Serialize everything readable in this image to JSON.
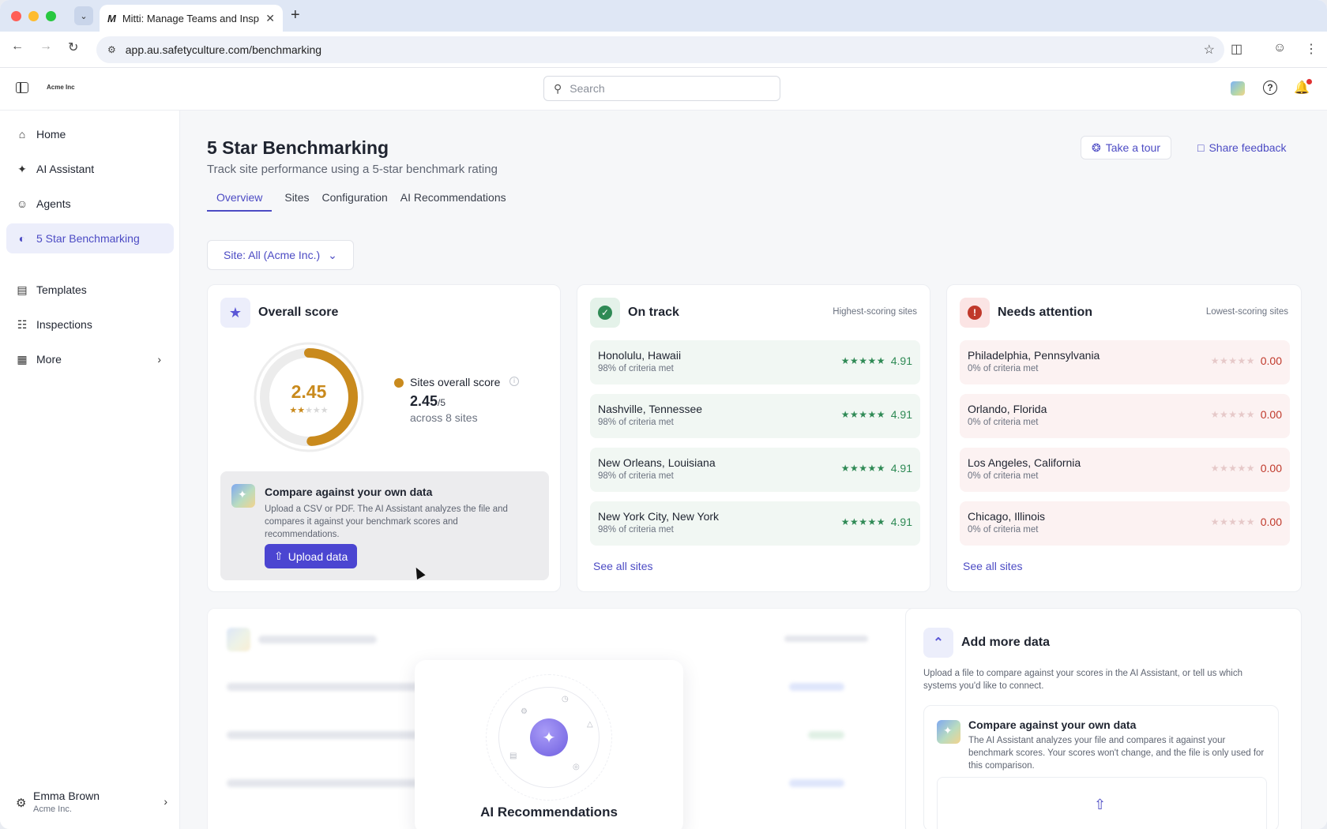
{
  "browser": {
    "tab_title": "Mitti: Manage Teams and Insp",
    "tab_favicon": "M",
    "url": "app.au.safetyculture.com/benchmarking"
  },
  "header": {
    "logo_text": "Acme Inc",
    "search_placeholder": "Search"
  },
  "sidebar": {
    "items": [
      {
        "label": "Home",
        "icon": "home-icon"
      },
      {
        "label": "AI Assistant",
        "icon": "sparkle-icon"
      },
      {
        "label": "Agents",
        "icon": "robot-icon"
      },
      {
        "label": "5 Star Benchmarking",
        "icon": "gauge-icon"
      },
      {
        "label": "Templates",
        "icon": "template-icon"
      },
      {
        "label": "Inspections",
        "icon": "clipboard-icon"
      },
      {
        "label": "More",
        "icon": "grid-icon"
      }
    ],
    "user": {
      "name": "Emma Brown",
      "org": "Acme Inc."
    }
  },
  "page": {
    "title": "5 Star Benchmarking",
    "subtitle": "Track site performance using a 5-star benchmark rating",
    "take_tour": "Take a tour",
    "share_feedback": "Share feedback",
    "tabs": [
      "Overview",
      "Sites",
      "Configuration",
      "AI Recommendations"
    ],
    "active_tab": "Overview",
    "site_filter": "Site: All (Acme Inc.)"
  },
  "overall": {
    "title": "Overall score",
    "score": "2.45",
    "score_value": 2.45,
    "score_max": 5,
    "legend_label": "Sites overall score",
    "score_text": "2.45",
    "denominator": "/5",
    "sites_text": "across 8 sites",
    "accent": "#c98a1d",
    "compare": {
      "title": "Compare against your own data",
      "desc": "Upload a CSV or PDF. The AI Assistant analyzes the file and compares it against your benchmark scores and recommendations.",
      "button": "Upload data"
    }
  },
  "on_track": {
    "title": "On track",
    "hint": "Highest-scoring sites",
    "see_all": "See all sites",
    "color": "#2f8a55",
    "sites": [
      {
        "name": "Honolulu, Hawaii",
        "meta": "98% of criteria met",
        "score": "4.91"
      },
      {
        "name": "Nashville, Tennessee",
        "meta": "98% of criteria met",
        "score": "4.91"
      },
      {
        "name": "New Orleans, Louisiana",
        "meta": "98% of criteria met",
        "score": "4.91"
      },
      {
        "name": "New York City, New York",
        "meta": "98% of criteria met",
        "score": "4.91"
      }
    ]
  },
  "needs_attention": {
    "title": "Needs attention",
    "hint": "Lowest-scoring sites",
    "see_all": "See all sites",
    "color": "#c0392b",
    "sites": [
      {
        "name": "Philadelphia, Pennsylvania",
        "meta": "0% of criteria met",
        "score": "0.00"
      },
      {
        "name": "Orlando, Florida",
        "meta": "0% of criteria met",
        "score": "0.00"
      },
      {
        "name": "Los Angeles, California",
        "meta": "0% of criteria met",
        "score": "0.00"
      },
      {
        "name": "Chicago, Illinois",
        "meta": "0% of criteria met",
        "score": "0.00"
      }
    ]
  },
  "ai_recommendations": {
    "title": "AI Recommendations"
  },
  "add_more": {
    "title": "Add more data",
    "desc": "Upload a file to compare against your scores in the AI Assistant, or tell us which systems you'd like to connect.",
    "inner_title": "Compare against your own data",
    "inner_desc": "The AI Assistant analyzes your file and compares it against your benchmark scores. Your scores won't change, and the file is only used for this comparison."
  },
  "colors": {
    "brand": "#4c4bc4",
    "good": "#2f8a55",
    "bad": "#c0392b"
  }
}
